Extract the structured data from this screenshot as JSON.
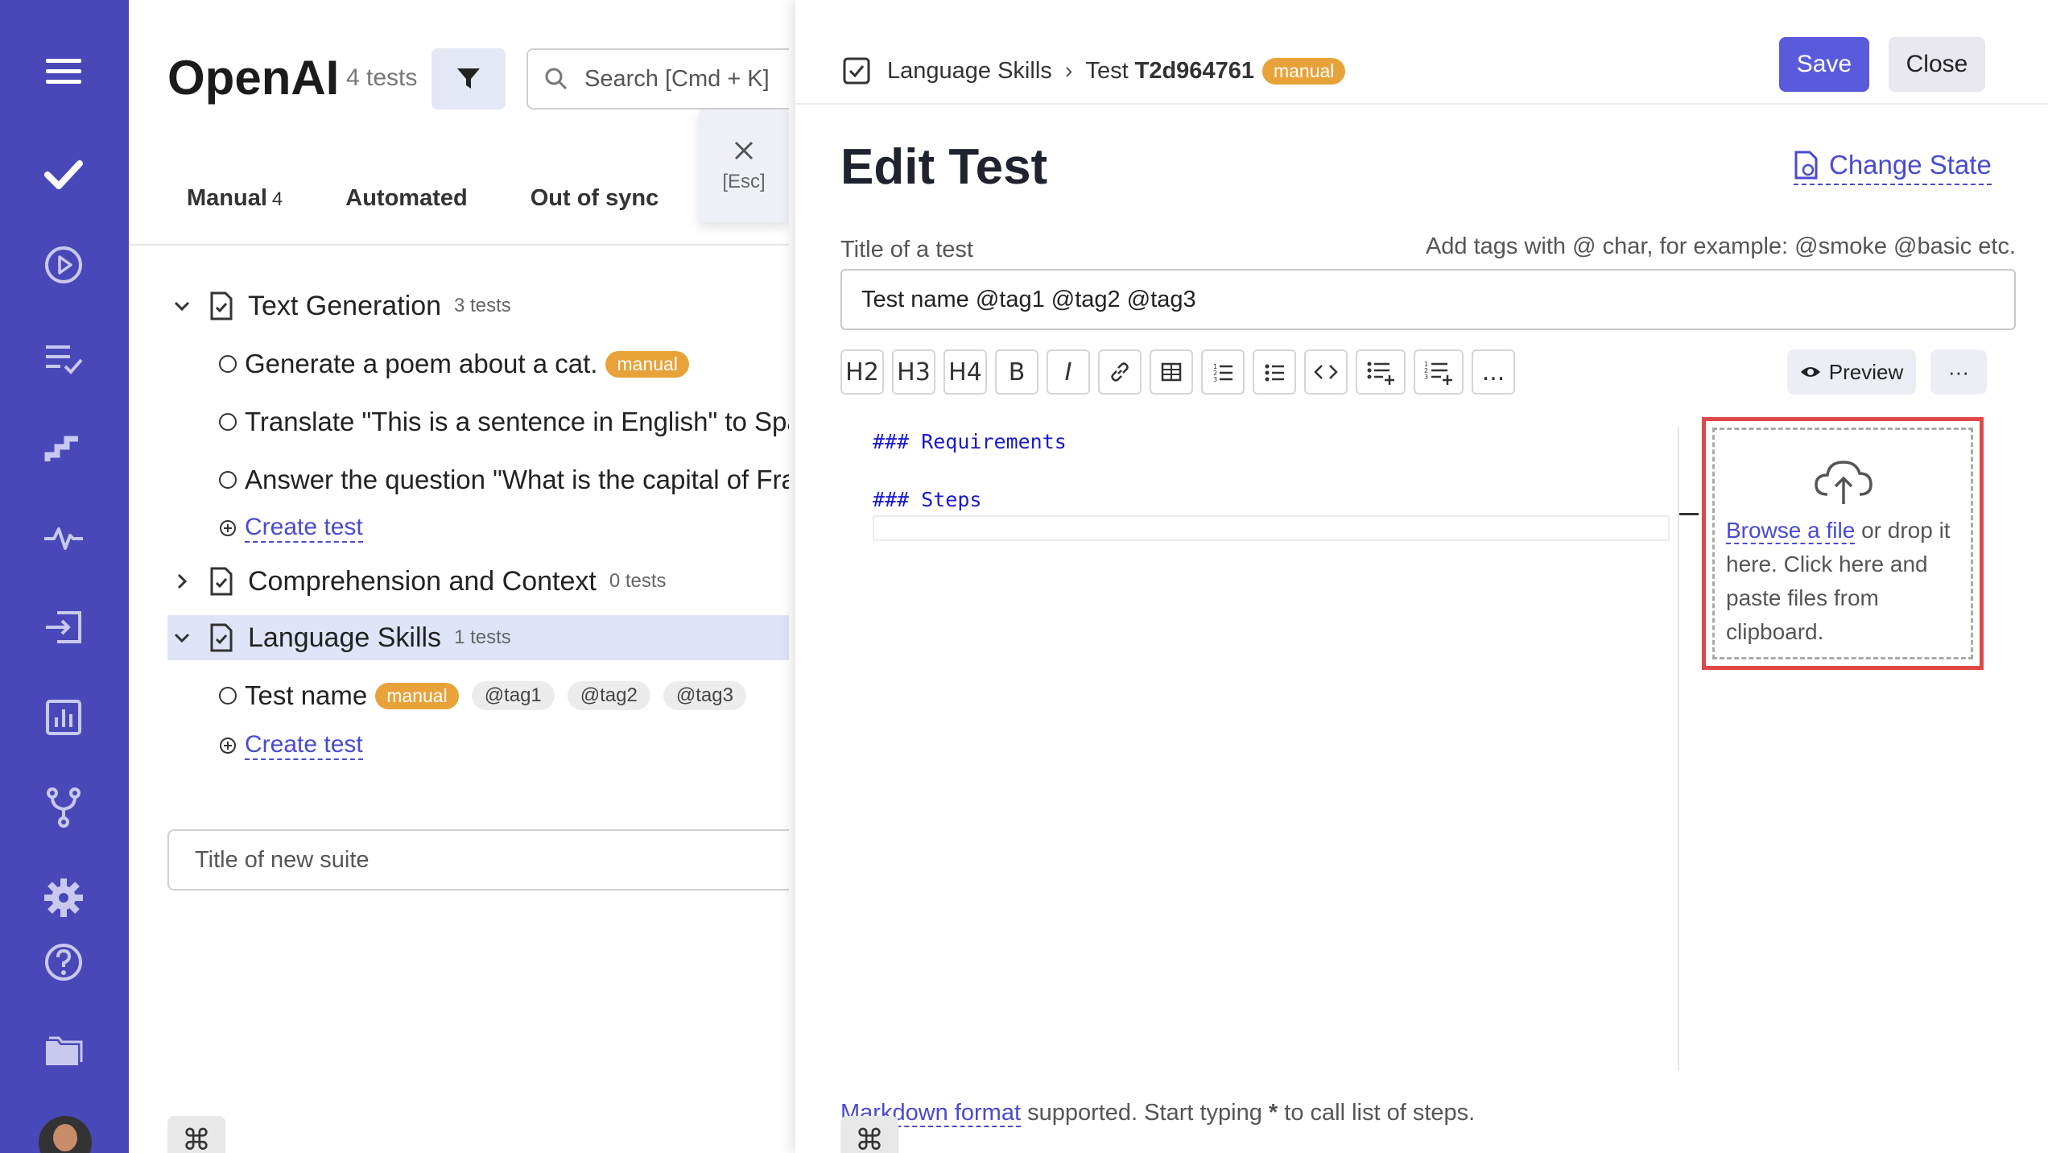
{
  "colors": {
    "rail": "#4848b8",
    "accent": "#5a5adc",
    "link": "#4a4ad0",
    "badge": "#e8a23a",
    "highlight": "#e04848"
  },
  "rail": {
    "icons": [
      "menu-icon",
      "check-icon",
      "play-icon",
      "list-check-icon",
      "steps-icon",
      "pulse-icon",
      "import-icon",
      "chart-icon",
      "branch-icon",
      "gear-icon",
      "help-icon",
      "folder-icon"
    ]
  },
  "project": {
    "title": "OpenAI",
    "count": "4 tests"
  },
  "search": {
    "placeholder": "Search [Cmd + K]"
  },
  "esc": {
    "label": "[Esc]"
  },
  "tabs": [
    {
      "label": "Manual",
      "count": "4"
    },
    {
      "label": "Automated",
      "count": ""
    },
    {
      "label": "Out of sync",
      "count": ""
    }
  ],
  "suites": [
    {
      "name": "Text Generation",
      "count": "3 tests",
      "tests": [
        {
          "name": "Generate a poem about a cat.",
          "badge": "manual"
        },
        {
          "name": "Translate \"This is a sentence in English\" to Spa",
          "badge": ""
        },
        {
          "name": "Answer the question \"What is the capital of Fra",
          "badge": ""
        }
      ],
      "create_label": "Create test"
    },
    {
      "name": "Comprehension and Context",
      "count": "0 tests"
    },
    {
      "name": "Language Skills",
      "count": "1 tests",
      "tests": [
        {
          "name": "Test name",
          "badge": "manual",
          "tags": [
            "@tag1",
            "@tag2",
            "@tag3"
          ]
        }
      ],
      "create_label": "Create test"
    }
  ],
  "new_suite": {
    "placeholder": "Title of new suite"
  },
  "cmd_symbol": "⌘",
  "edit": {
    "breadcrumb": {
      "suite": "Language Skills",
      "separator": "›",
      "test_prefix": "Test",
      "test_id": "T2d964761",
      "badge": "manual"
    },
    "save_label": "Save",
    "close_label": "Close",
    "title": "Edit Test",
    "change_state": "Change State",
    "title_label": "Title of a test",
    "tags_hint": "Add tags with @ char, for example: @smoke @basic etc.",
    "title_value": "Test name @tag1 @tag2 @tag3",
    "toolbar": [
      "H2",
      "H3",
      "H4",
      "B",
      "I",
      "link",
      "table",
      "ordered-list",
      "bullet-list",
      "code",
      "add-step",
      "add-ordered-step",
      "..."
    ],
    "preview_label": "Preview",
    "more_label": "···",
    "content_lines": [
      "### Requirements",
      "### Steps"
    ],
    "drop": {
      "browse": "Browse a file",
      "drop": "or drop it here.",
      "paste": "Click here and paste files from clipboard."
    },
    "md_hint": {
      "link": "Markdown format",
      "rest": " supported. Start typing ",
      "star": "*",
      "end": " to call list of steps."
    }
  }
}
